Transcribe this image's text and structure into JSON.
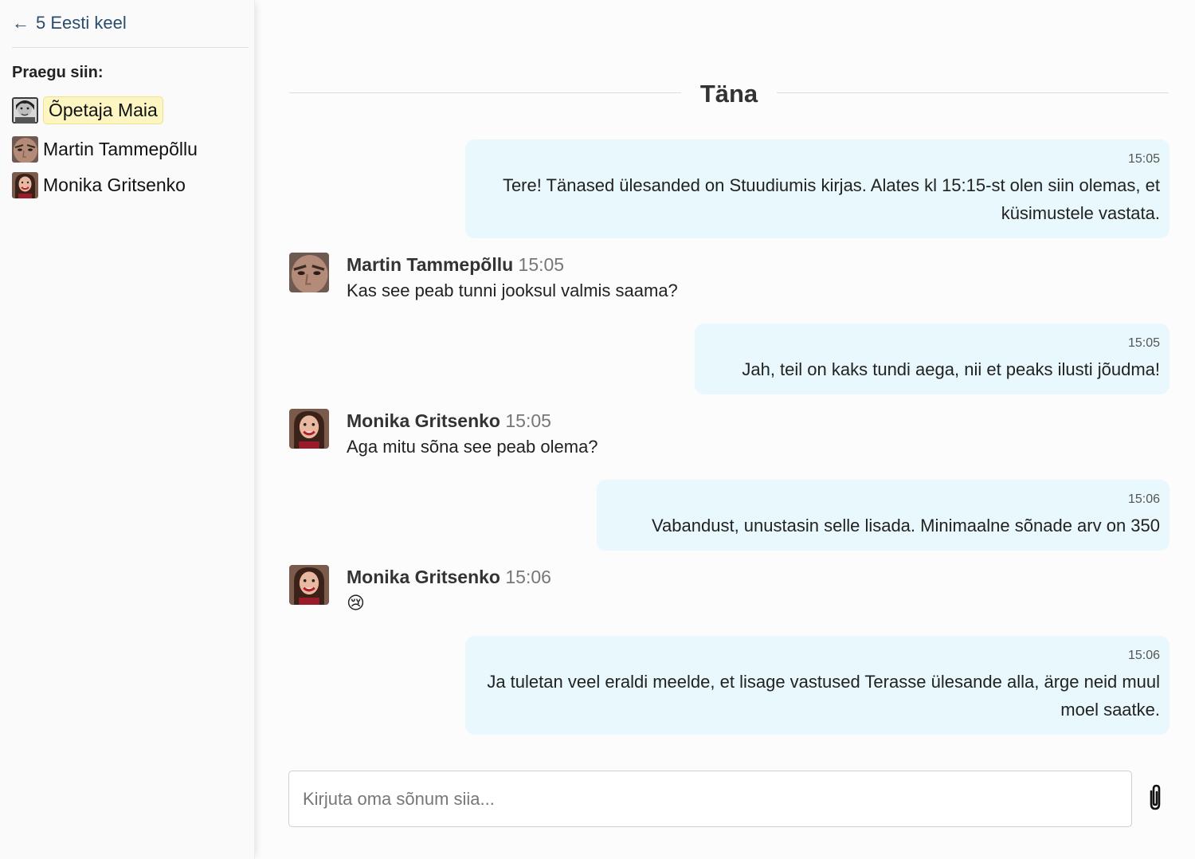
{
  "sidebar": {
    "back_arrow": "←",
    "back_label": "5 Eesti keel",
    "present_heading": "Praegu siin:",
    "participants": [
      {
        "name": "Õpetaja Maia",
        "highlighted": true,
        "avatar": "teacher-avatar"
      },
      {
        "name": "Martin Tammepõllu",
        "highlighted": false,
        "avatar": "martin-avatar"
      },
      {
        "name": "Monika Gritsenko",
        "highlighted": false,
        "avatar": "monika-avatar"
      }
    ]
  },
  "chat": {
    "day_label": "Täna",
    "messages": [
      {
        "type": "outgoing",
        "time": "15:05",
        "text": "Tere! Tänased ülesanded on Stuudiumis kirjas. Alates kl 15:15-st olen siin olemas, et küsimustele vastata."
      },
      {
        "type": "incoming",
        "sender": "Martin Tammepõllu",
        "time": "15:05",
        "text": "Kas see peab tunni jooksul valmis saama?"
      },
      {
        "type": "outgoing",
        "time": "15:05",
        "text": "Jah, teil on kaks tundi aega, nii et peaks ilusti jõudma!"
      },
      {
        "type": "incoming",
        "sender": "Monika Gritsenko",
        "time": "15:05",
        "text": "Aga mitu sõna see peab olema?"
      },
      {
        "type": "outgoing",
        "time": "15:06",
        "text": "Vabandust, unustasin selle lisada. Minimaalne sõnade arv on 350"
      },
      {
        "type": "incoming",
        "sender": "Monika Gritsenko",
        "time": "15:06",
        "text": "😢"
      },
      {
        "type": "outgoing",
        "time": "15:06",
        "text": "Ja tuletan veel eraldi meelde, et lisage vastused Terasse ülesande alla, ärge neid muul moel saatke."
      }
    ]
  },
  "composer": {
    "value": "",
    "placeholder": "Kirjuta oma sõnum siia..."
  },
  "colors": {
    "outgoing_bubble": "#e8f8fc",
    "highlight": "#fdf6c3",
    "link": "#2a4d6e"
  },
  "icons": {
    "back": "arrow-left-icon",
    "attach": "paperclip-icon"
  }
}
